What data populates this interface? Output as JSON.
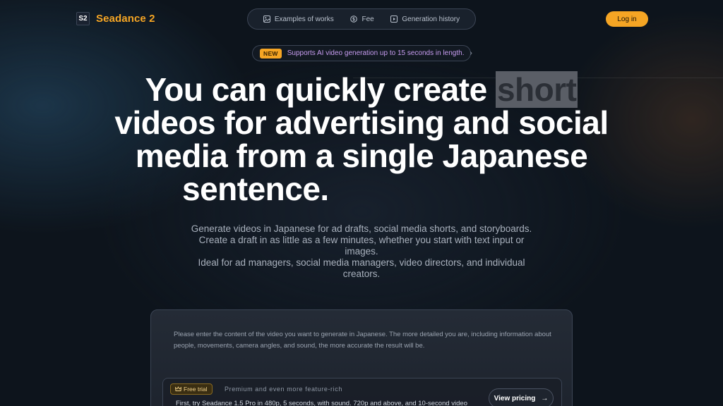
{
  "header": {
    "logo_badge": "S2",
    "logo_text": "Seadance 2",
    "nav": [
      {
        "label": "Examples of works",
        "icon": "image-icon"
      },
      {
        "label": "Fee",
        "icon": "coin-icon"
      },
      {
        "label": "Generation history",
        "icon": "history-icon"
      }
    ],
    "login_label": "Log in"
  },
  "announcement": {
    "badge": "NEW",
    "text": "Supports AI video generation up to 15 seconds in length.",
    "chevron": "›"
  },
  "hero": {
    "line1_a": "You can quickly create ",
    "line1_highlight": "short",
    "line2": "videos for advertising and social",
    "line3": "media from a single Japanese",
    "line4": "sentence."
  },
  "subtitle": [
    "Generate videos in Japanese for ad drafts, social media shorts, and storyboards.",
    "Create a draft in as little as a few minutes, whether you start with text input or",
    "images.",
    "Ideal for ad managers, social media managers, video directors, and individual",
    "creators."
  ],
  "card": {
    "prompt_placeholder": "Please enter the content of the video you want to generate in Japanese. The more detailed you are, including information about people, movements, camera angles, and sound, the more accurate the result will be.",
    "trial": {
      "badge": "Free trial",
      "title": "Premium and even more feature-rich",
      "description": "First, try Seadance 1.5 Pro in 480p, 5 seconds, with sound. 720p and above, and 10-second video",
      "button_label": "View pricing",
      "button_arrow": "→"
    }
  },
  "colors": {
    "accent": "#f5a524",
    "announcement_text": "#c79cf0",
    "background": "#0d141c"
  }
}
